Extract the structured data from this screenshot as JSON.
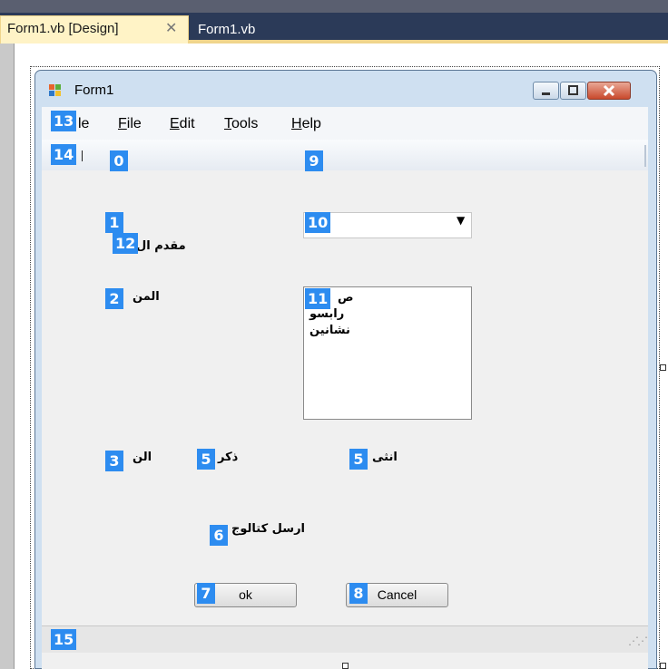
{
  "ide": {
    "tabs": [
      {
        "label": "Form1.vb [Design]",
        "close_glyph": "✕",
        "active": true
      },
      {
        "label": "Form1.vb",
        "active": false
      }
    ]
  },
  "form": {
    "title": "Form1",
    "icon": "windows-form-icon",
    "window_buttons": [
      "minimize-icon",
      "maximize-icon",
      "close-icon"
    ]
  },
  "menu": {
    "items": [
      {
        "mnemonic": "F",
        "rest": "ile",
        "badge_covers": true
      },
      {
        "mnemonic": "F",
        "rest": "ile"
      },
      {
        "mnemonic": "E",
        "rest": "dit"
      },
      {
        "mnemonic": "T",
        "rest": "ools"
      },
      {
        "mnemonic": "H",
        "rest": "elp"
      }
    ],
    "first_visible": "le"
  },
  "labels": {
    "l12_text": "مقدم ال",
    "l2_text": "المن",
    "l3_text": "الن",
    "male_text": "ذكر",
    "female_text": "انثى",
    "catalog_text": "ارسل كتالوج",
    "list_head": "ص"
  },
  "listbox": {
    "items": [
      "رابسو",
      "نشانين"
    ]
  },
  "buttons": {
    "ok": "ok",
    "cancel": "Cancel"
  },
  "badges": {
    "b0": "0",
    "b1": "1",
    "b2": "2",
    "b3": "3",
    "b5a": "5",
    "b5b": "5",
    "b6": "6",
    "b7": "7",
    "b8": "8",
    "b9": "9",
    "b10": "10",
    "b11": "11",
    "b12": "12",
    "b13": "13",
    "b14": "14",
    "b15": "15"
  },
  "colors": {
    "badge": "#2d8cf0",
    "tab_active": "#fff3c6",
    "tabbar": "#2b3a58"
  }
}
